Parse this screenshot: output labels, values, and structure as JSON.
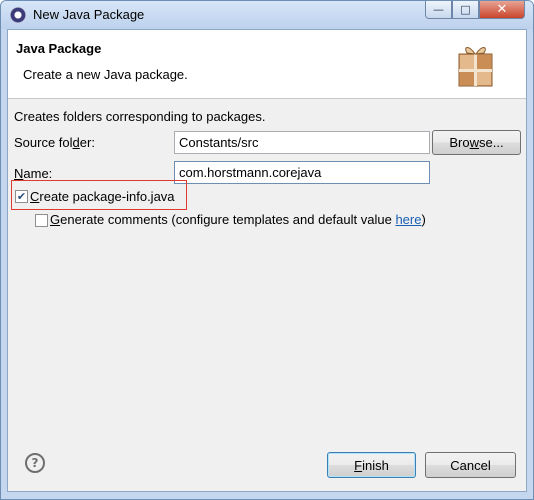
{
  "window": {
    "title": "New Java Package",
    "controls": {
      "minimize": "—",
      "maximize": "□",
      "close": "✕"
    }
  },
  "header": {
    "title": "Java Package",
    "description": "Create a new Java package.",
    "icon": "package-icon"
  },
  "content": {
    "description": "Creates folders corresponding to packages.",
    "source_folder": {
      "label_pre": "Source fol",
      "label_mnemonic": "d",
      "label_post": "er:",
      "value": "Constants/src"
    },
    "browse_button": {
      "mnemonic": "w",
      "label_pre": "Bro",
      "label_post": "se..."
    },
    "name": {
      "label_mnemonic": "N",
      "label_post": "ame:",
      "value": "com.horstmann.corejava"
    },
    "create_package_info": {
      "checked": true,
      "mnemonic": "C",
      "label_post": "reate package-info.java"
    },
    "generate_comments": {
      "checked": false,
      "mnemonic": "G",
      "label_post": "enerate comments (configure templates and default value ",
      "link": "here",
      "suffix": ")"
    }
  },
  "footer": {
    "help_icon": "?",
    "finish_button": {
      "mnemonic": "F",
      "label_post": "inish"
    },
    "cancel_button": {
      "label": "Cancel"
    }
  },
  "colors": {
    "highlight_border": "#e03a2e",
    "link": "#1a5fb4",
    "title_bar": "#c4d7ee"
  }
}
